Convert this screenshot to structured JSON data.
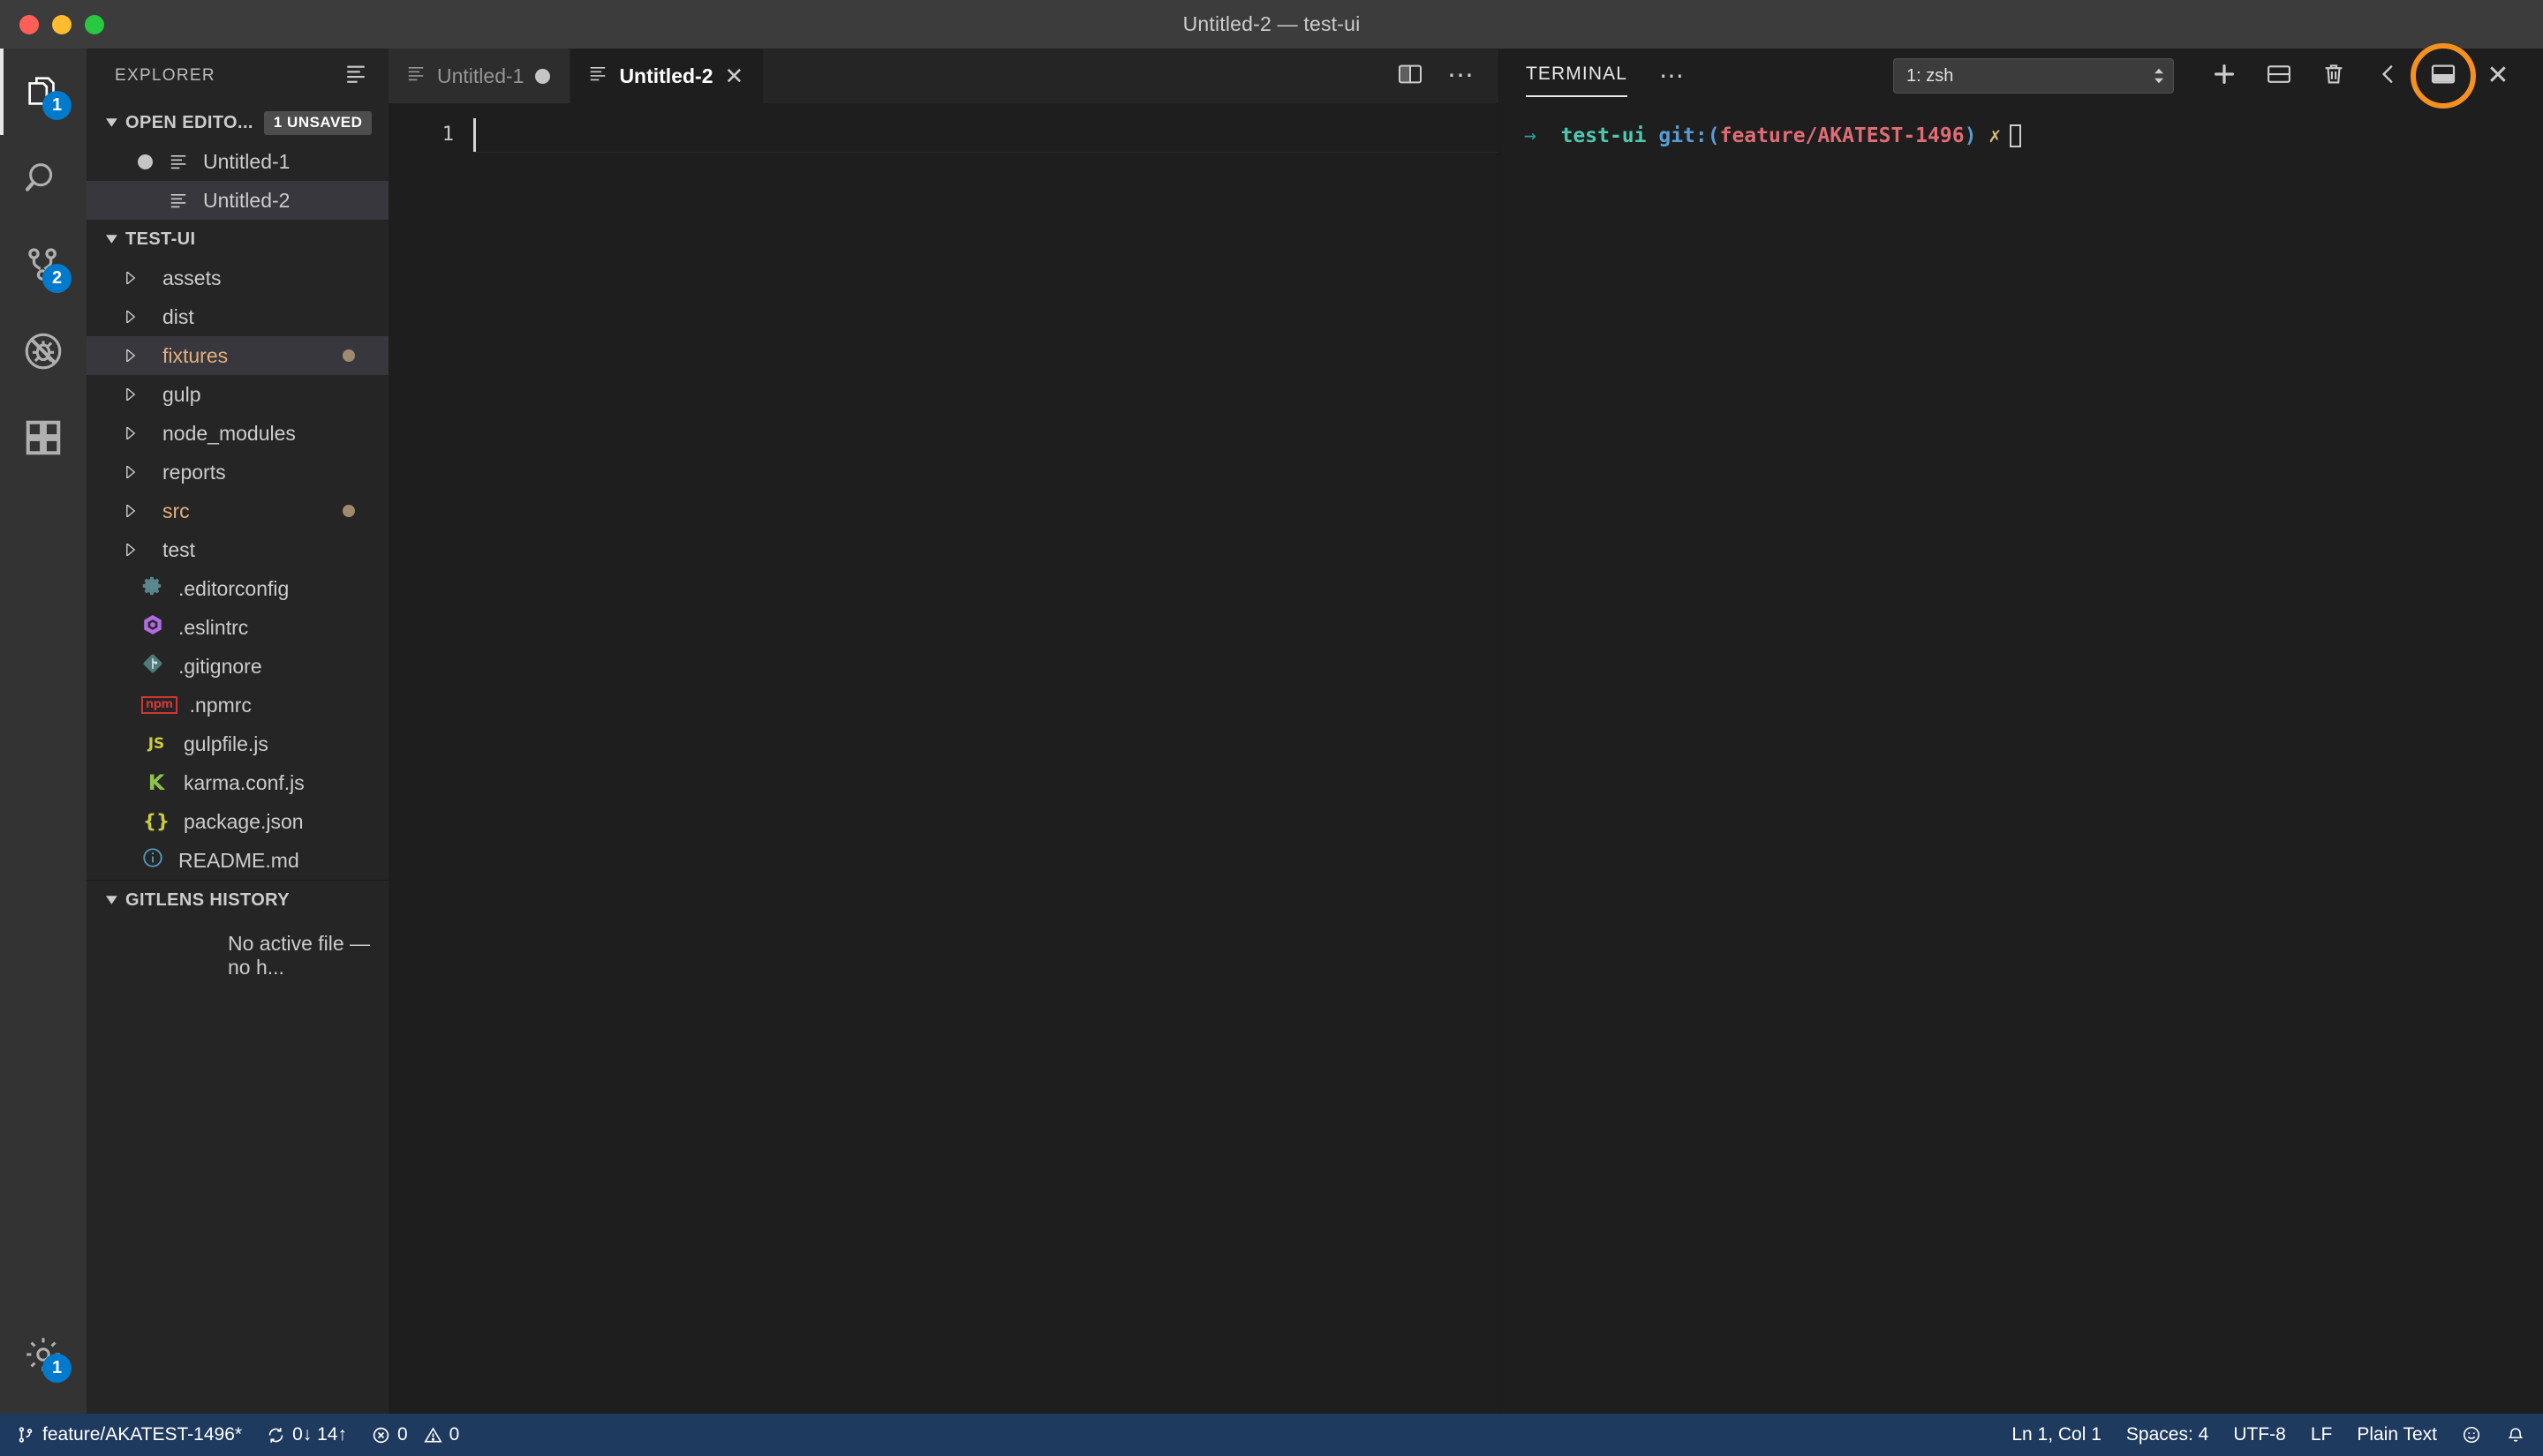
{
  "window": {
    "title": "Untitled-2 — test-ui",
    "traffic_lights": [
      "close-red",
      "minimize-yellow",
      "maximize-green"
    ]
  },
  "accent_colors": {
    "badge_blue": "#007acc",
    "status_bar_blue": "#1e3a5f",
    "git_modified_orange": "#e2b07e",
    "highlight_ring_orange": "#f59021"
  },
  "activity_bar": {
    "items": [
      {
        "name": "explorer",
        "icon": "files-icon",
        "badge": "1",
        "active": true
      },
      {
        "name": "search",
        "icon": "search-icon",
        "badge": "",
        "active": false
      },
      {
        "name": "source-control",
        "icon": "source-control-icon",
        "badge": "2",
        "active": false
      },
      {
        "name": "debug",
        "icon": "debug-no-bug-icon",
        "badge": "",
        "active": false
      },
      {
        "name": "extensions",
        "icon": "extensions-icon",
        "badge": "",
        "active": false
      }
    ],
    "bottom_items": [
      {
        "name": "manage-settings",
        "icon": "gear-icon",
        "badge": "1"
      }
    ]
  },
  "sidebar": {
    "title": "EXPLORER",
    "open_editors": {
      "header": "OPEN EDITO...",
      "badge": "1 UNSAVED",
      "expanded": true,
      "items": [
        {
          "label": "Untitled-1",
          "dirty": true,
          "selected": false,
          "icon": "text-file-icon"
        },
        {
          "label": "Untitled-2",
          "dirty": false,
          "selected": true,
          "icon": "text-file-icon"
        }
      ]
    },
    "folder": {
      "header": "TEST-UI",
      "expanded": true,
      "items": [
        {
          "label": "assets",
          "type": "folder",
          "expanded": false,
          "modified": false,
          "dot": false,
          "icon": "folder-arrow-icon"
        },
        {
          "label": "dist",
          "type": "folder",
          "expanded": false,
          "modified": false,
          "dot": false,
          "icon": "folder-arrow-icon"
        },
        {
          "label": "fixtures",
          "type": "folder",
          "expanded": false,
          "modified": true,
          "dot": true,
          "selected": true,
          "icon": "folder-arrow-icon"
        },
        {
          "label": "gulp",
          "type": "folder",
          "expanded": false,
          "modified": false,
          "dot": false,
          "icon": "folder-arrow-icon"
        },
        {
          "label": "node_modules",
          "type": "folder",
          "expanded": false,
          "modified": false,
          "dot": false,
          "icon": "folder-arrow-icon"
        },
        {
          "label": "reports",
          "type": "folder",
          "expanded": false,
          "modified": false,
          "dot": false,
          "icon": "folder-arrow-icon"
        },
        {
          "label": "src",
          "type": "folder",
          "expanded": false,
          "modified": true,
          "dot": true,
          "icon": "folder-arrow-icon"
        },
        {
          "label": "test",
          "type": "folder",
          "expanded": false,
          "modified": false,
          "dot": false,
          "icon": "folder-arrow-icon"
        },
        {
          "label": ".editorconfig",
          "type": "file",
          "icon": "editorconfig-gear-icon",
          "glyph": "⚙",
          "color": "#5c8b92"
        },
        {
          "label": ".eslintrc",
          "type": "file",
          "icon": "eslint-hexagon-icon",
          "glyph": "⬢",
          "color": "#b36ae2"
        },
        {
          "label": ".gitignore",
          "type": "file",
          "icon": "git-diamond-icon",
          "glyph": "◆",
          "color": "#5f8787"
        },
        {
          "label": ".npmrc",
          "type": "file",
          "icon": "npm-icon",
          "glyph": "npm",
          "color": "#cb3837"
        },
        {
          "label": "gulpfile.js",
          "type": "file",
          "icon": "javascript-icon",
          "glyph": "JS",
          "color": "#cbcb41"
        },
        {
          "label": "karma.conf.js",
          "type": "file",
          "icon": "karma-icon",
          "glyph": "K",
          "color": "#8dc149"
        },
        {
          "label": "package.json",
          "type": "file",
          "icon": "json-braces-icon",
          "glyph": "{}",
          "color": "#cbcb41"
        },
        {
          "label": "README.md",
          "type": "file",
          "icon": "info-circle-icon",
          "glyph": "ⓘ",
          "color": "#519aba"
        }
      ]
    },
    "gitlens": {
      "header": "GITLENS HISTORY",
      "expanded": true,
      "empty_text": "No active file — no h..."
    }
  },
  "editor": {
    "tabs": [
      {
        "label": "Untitled-1",
        "active": false,
        "dirty": true,
        "closable": false,
        "icon": "text-file-icon"
      },
      {
        "label": "Untitled-2",
        "active": true,
        "dirty": false,
        "closable": true,
        "icon": "text-file-icon"
      }
    ],
    "tab_actions": [
      {
        "name": "split-editor-button",
        "icon": "split-editor-icon"
      },
      {
        "name": "more-actions-button",
        "icon": "ellipsis-icon",
        "glyph": "⋯"
      }
    ],
    "line_numbers": [
      "1"
    ],
    "content": ""
  },
  "panel": {
    "tab_label": "TERMINAL",
    "more_glyph": "⋯",
    "terminal_select": {
      "value": "1: zsh",
      "options": [
        "1: zsh"
      ]
    },
    "actions": [
      {
        "name": "new-terminal-button",
        "icon": "plus-icon"
      },
      {
        "name": "split-terminal-button",
        "icon": "split-terminal-icon"
      },
      {
        "name": "kill-terminal-button",
        "icon": "trash-icon"
      },
      {
        "name": "previous-button",
        "icon": "chevron-left-icon"
      },
      {
        "name": "maximize-panel-button",
        "icon": "maximize-panel-icon",
        "highlighted": true
      },
      {
        "name": "close-panel-button",
        "icon": "close-icon",
        "glyph": "✕"
      }
    ],
    "terminal": {
      "prompt_arrow": "→",
      "directory": "test-ui",
      "git_keyword": "git:(",
      "branch": "feature/AKATEST-1496",
      "git_close": ")",
      "dirty_marker": "✗",
      "input": ""
    }
  },
  "status_bar": {
    "left": [
      {
        "name": "branch",
        "icon": "source-control-icon",
        "label": "feature/AKATEST-1496*"
      },
      {
        "name": "sync",
        "icon": "sync-icon",
        "label": "0↓ 14↑"
      },
      {
        "name": "problems",
        "icon": "error-icon",
        "label": "0",
        "warning_icon": "warning-icon",
        "warning_label": "0"
      }
    ],
    "right": [
      {
        "name": "cursor-position",
        "label": "Ln 1, Col 1"
      },
      {
        "name": "indentation",
        "label": "Spaces: 4"
      },
      {
        "name": "encoding",
        "label": "UTF-8"
      },
      {
        "name": "eol",
        "label": "LF"
      },
      {
        "name": "language-mode",
        "label": "Plain Text"
      },
      {
        "name": "feedback",
        "icon": "smiley-icon",
        "label": ""
      },
      {
        "name": "notifications",
        "icon": "bell-icon",
        "label": ""
      }
    ]
  }
}
